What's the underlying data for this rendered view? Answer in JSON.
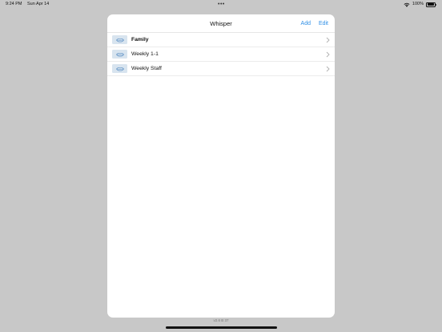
{
  "status_bar": {
    "time": "9:24 PM",
    "date": "Sun Apr 14",
    "dots": "•••",
    "battery": "100%"
  },
  "nav": {
    "title": "Whisper",
    "add_label": "Add",
    "edit_label": "Edit"
  },
  "list": [
    {
      "label": "Family"
    },
    {
      "label": "Weekly 1-1"
    },
    {
      "label": "Weekly Staff"
    }
  ],
  "footer": {
    "version": "v2.6 B 37"
  },
  "colors": {
    "accent": "#2f8fe6",
    "background": "#c8c8c8",
    "thumb": "#d8e4ef"
  }
}
